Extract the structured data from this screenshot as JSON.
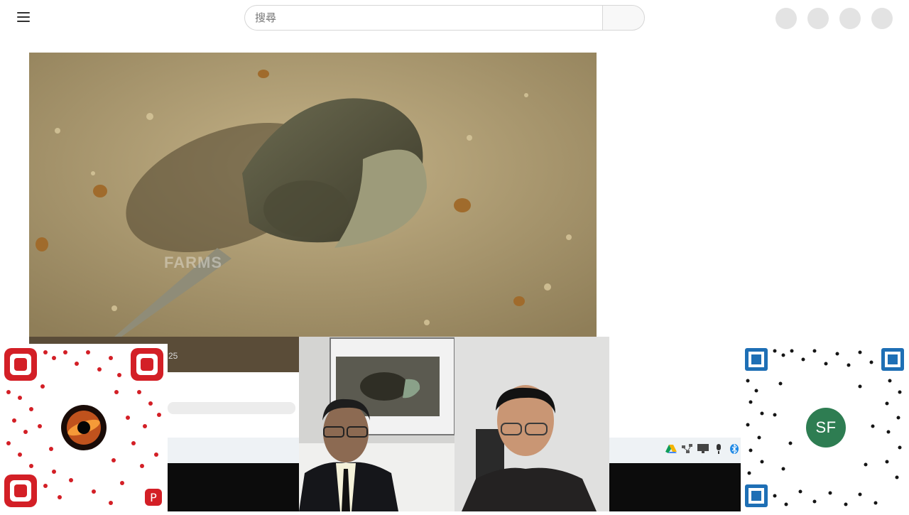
{
  "header": {
    "search_placeholder": "搜尋"
  },
  "video": {
    "watermark_text": "FARMS",
    "time_fragment": "25"
  },
  "qr_right": {
    "badge_text": "SF"
  },
  "colors": {
    "qr_red": "#d31f26",
    "qr_blue": "#1e6fb5",
    "badge_green": "#2e7d52"
  },
  "tray_icons": [
    "drive-icon",
    "network-icon",
    "monitor-icon",
    "microphone-icon",
    "bluetooth-icon"
  ]
}
